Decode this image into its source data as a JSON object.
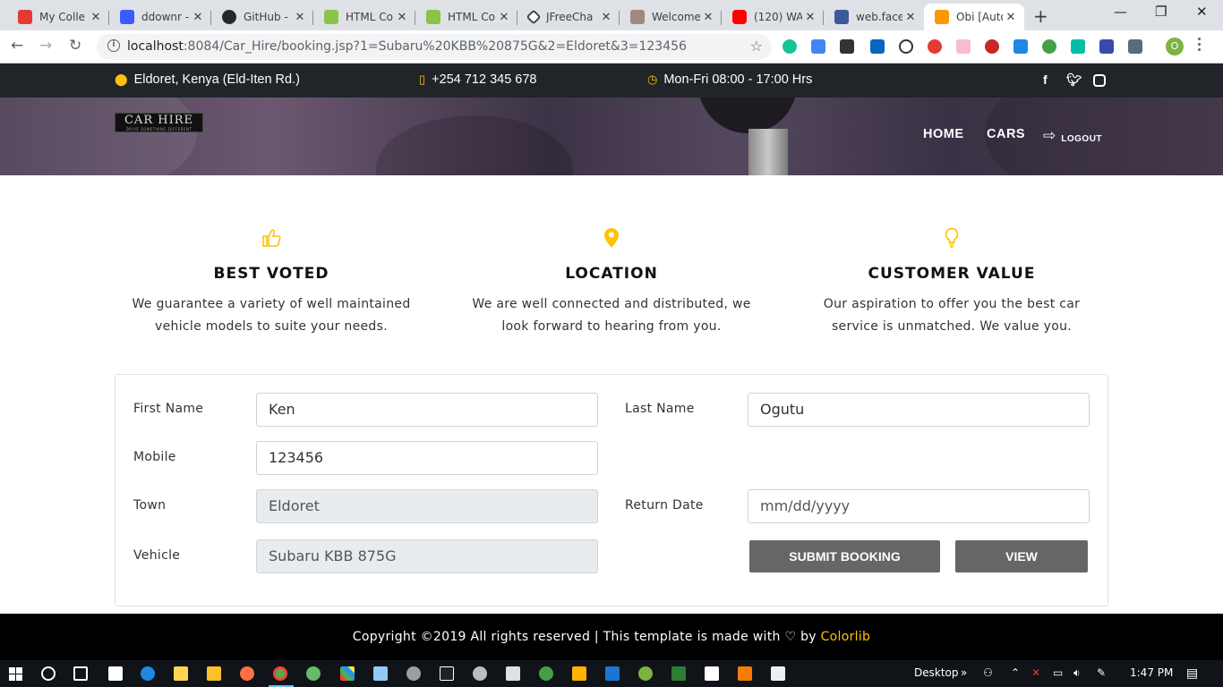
{
  "browser": {
    "tabs": [
      {
        "label": "My Colle",
        "favicon": "red",
        "close": "✕"
      },
      {
        "label": "ddownr -",
        "favicon": "blue",
        "close": "✕"
      },
      {
        "label": "GitHub -",
        "favicon": "github",
        "close": "✕"
      },
      {
        "label": "HTML Co",
        "favicon": "green",
        "close": "✕"
      },
      {
        "label": "HTML Co",
        "favicon": "green",
        "close": "✕"
      },
      {
        "label": "JFreeCha",
        "favicon": "diamond",
        "close": "✕"
      },
      {
        "label": "Welcome",
        "favicon": "brown",
        "close": "✕"
      },
      {
        "label": "(120) WA",
        "favicon": "youtube",
        "close": "✕"
      },
      {
        "label": "web.facel",
        "favicon": "facebook",
        "close": "✕"
      },
      {
        "label": "Obi [Auto",
        "favicon": "orange",
        "close": "✕"
      }
    ],
    "new_tab": "+",
    "window_controls": {
      "minimize": "—",
      "maximize": "❐",
      "close": "✕"
    },
    "url_host": "localhost",
    "url_rest": ":8084/Car_Hire/booking.jsp?1=Subaru%20KBB%20875G&2=Eldoret&3=123456",
    "profile_initial": "O"
  },
  "topbar": {
    "address": "Eldoret, Kenya (Eld-Iten Rd.)",
    "phone": "+254 712 345 678",
    "hours": "Mon-Fri 08:00 - 17:00 Hrs",
    "social": [
      "f",
      "t",
      "ig"
    ]
  },
  "header": {
    "logo_title": "CAR HIRE",
    "logo_tagline": "DRIVE SOMETHING DIFFERENT",
    "nav": {
      "home": "HOME",
      "cars": "CARS",
      "logout": "LOGOUT"
    }
  },
  "features": [
    {
      "title": "BEST VOTED",
      "text_line1": "We guarantee a variety of well maintained",
      "text_line2": "vehicle models to suite your needs.",
      "icon": "thumbs-up-icon"
    },
    {
      "title": "LOCATION",
      "text_line1": "We are well connected and distributed, we",
      "text_line2": "look forward to hearing from you.",
      "icon": "map-marker-icon"
    },
    {
      "title": "CUSTOMER VALUE",
      "text_line1": "Our aspiration to offer you the best car",
      "text_line2": "service is unmatched. We value you.",
      "icon": "lightbulb-icon"
    }
  ],
  "form": {
    "first_name_label": "First Name",
    "first_name_value": "Ken",
    "last_name_label": "Last Name",
    "last_name_value": "Ogutu",
    "mobile_label": "Mobile",
    "mobile_value": "123456",
    "town_label": "Town",
    "town_value": "Eldoret",
    "return_date_label": "Return Date",
    "return_date_placeholder": "mm/dd/yyyy",
    "vehicle_label": "Vehicle",
    "vehicle_value": "Subaru KBB 875G",
    "submit_label": "SUBMIT BOOKING",
    "view_label": "VIEW"
  },
  "footer": {
    "text": "Copyright ©2019 All rights reserved | This template is made with",
    "heart": "♡",
    "by": "by",
    "brand": "Colorlib"
  },
  "taskbar": {
    "desktop_label": "Desktop",
    "time": "1:47 PM"
  },
  "colors": {
    "accent": "#ffc107",
    "dark": "#212529",
    "button": "#666666"
  }
}
